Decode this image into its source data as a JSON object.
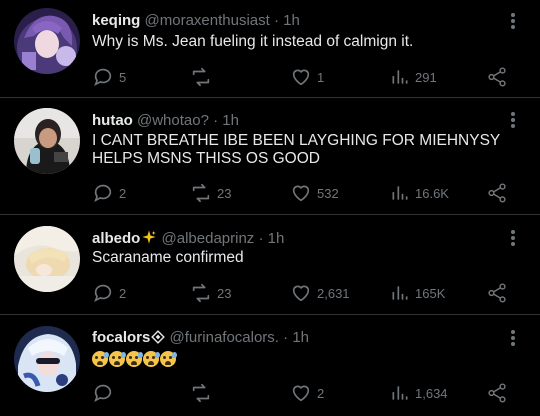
{
  "tweets": [
    {
      "name": "keqing",
      "handle": "@moraxenthusiast",
      "time": "· 1h",
      "text": "Why is Ms. Jean fueling it instead of calmign it.",
      "replies": "5",
      "retweets": "",
      "likes": "1",
      "views": "291"
    },
    {
      "name": "hutao",
      "handle": "@whotao?",
      "time": "· 1h",
      "text": "I CANT BREATHE IBE BEEN LAYGHING FOR MIEHNYSY HELPS MSNS THISS OS GOOD",
      "replies": "2",
      "retweets": "23",
      "likes": "532",
      "views": "16.6K"
    },
    {
      "name": "albedo",
      "handle": "@albedaprinz",
      "time": "· 1h",
      "text": "Scaraname confirmed",
      "replies": "2",
      "retweets": "23",
      "likes": "2,631",
      "views": "165K"
    },
    {
      "name": "focalors",
      "handle": "@furinafocalors.",
      "time": "· 1h",
      "text": "",
      "replies": "",
      "retweets": "",
      "likes": "2",
      "views": "1,634"
    }
  ],
  "icons": {
    "reply": "reply-icon",
    "retweet": "retweet-icon",
    "like": "heart-icon",
    "views": "views-icon",
    "share": "share-icon",
    "more": "more-icon",
    "albedo_badge": "sparkle-icon",
    "focalors_badge": "diamond-icon",
    "emoji": "anxious-sweat-face-emoji"
  },
  "colors": {
    "background": "#000000",
    "text": "#e7e9ea",
    "muted": "#71767b",
    "divider": "#2f3336"
  }
}
